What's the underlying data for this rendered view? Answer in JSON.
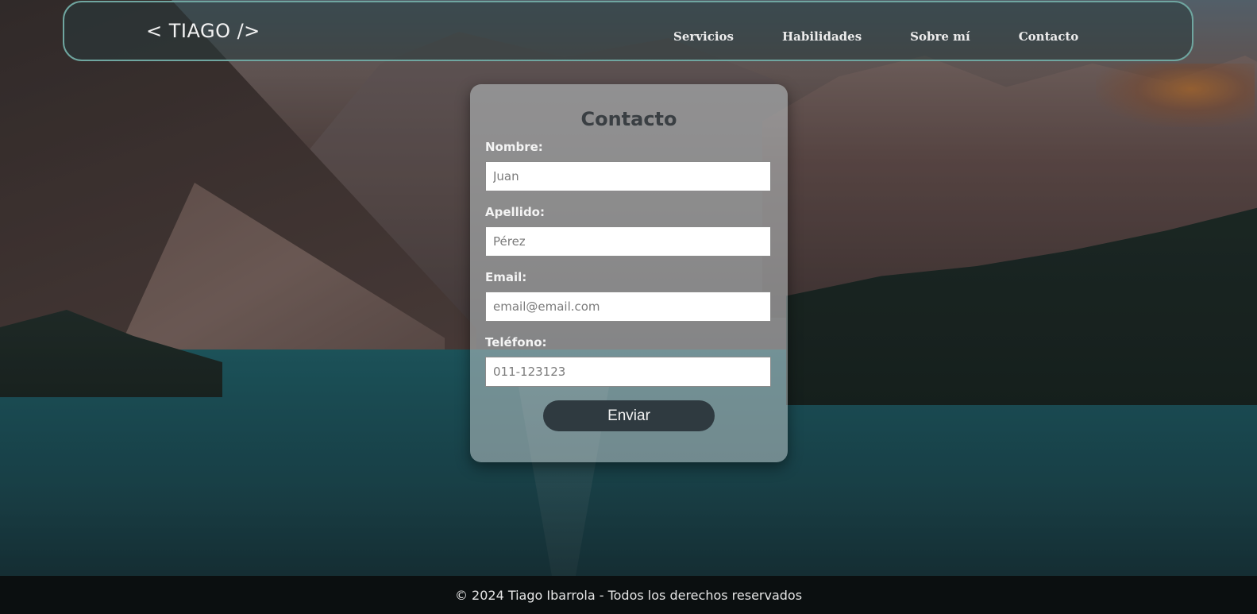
{
  "header": {
    "logo": "< TIAGO />",
    "nav": [
      {
        "label": "Servicios"
      },
      {
        "label": "Habilidades"
      },
      {
        "label": "Sobre mí"
      },
      {
        "label": "Contacto"
      }
    ]
  },
  "form": {
    "title": "Contacto",
    "fields": [
      {
        "label": "Nombre:",
        "placeholder": "Juan"
      },
      {
        "label": "Apellido:",
        "placeholder": "Pérez"
      },
      {
        "label": "Email:",
        "placeholder": "email@email.com"
      },
      {
        "label": "Teléfono:",
        "placeholder": "011-123123"
      }
    ],
    "submit_label": "Enviar"
  },
  "footer": {
    "text": "© 2024 Tiago Ibarrola - Todos los derechos reservados"
  },
  "colors": {
    "header_border": "#6fa6a0",
    "button_bg": "#2f3a40",
    "footer_bg": "#0b0f10"
  }
}
